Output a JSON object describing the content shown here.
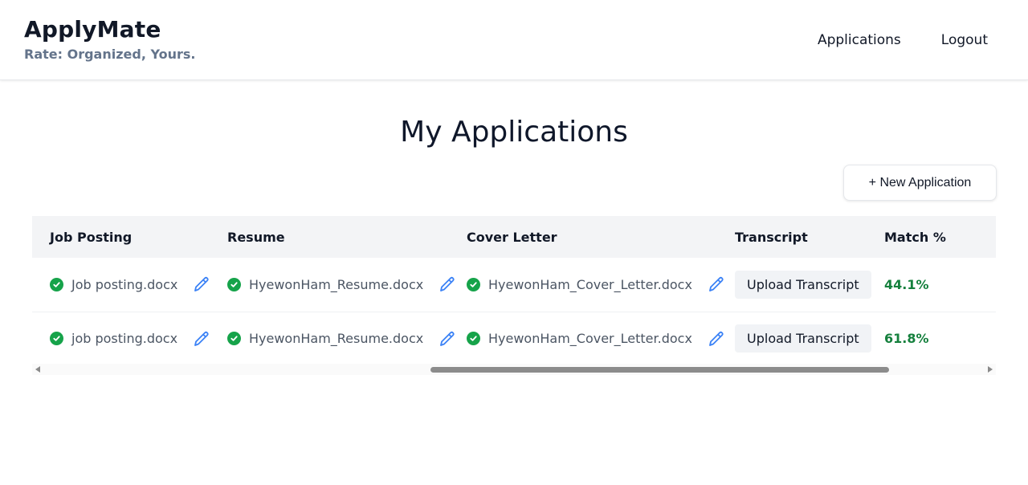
{
  "header": {
    "title": "ApplyMate",
    "tagline": "Rate: Organized, Yours.",
    "nav": [
      {
        "label": "Applications"
      },
      {
        "label": "Logout"
      }
    ]
  },
  "main": {
    "title": "My Applications",
    "new_button_label": "+ New Application"
  },
  "table": {
    "columns": [
      "Job Posting",
      "Resume",
      "Cover Letter",
      "Transcript",
      "Match %"
    ],
    "rows": [
      {
        "job_posting": "Job posting.docx",
        "resume": "HyewonHam_Resume.docx",
        "cover_letter": "HyewonHam_Cover_Letter.docx",
        "transcript_button": "Upload Transcript",
        "match": "44.1%"
      },
      {
        "job_posting": "job posting.docx",
        "resume": "HyewonHam_Resume.docx",
        "cover_letter": "HyewonHam_Cover_Letter.docx",
        "transcript_button": "Upload Transcript",
        "match": "61.8%"
      }
    ]
  },
  "icons": {
    "status": "check-circle-icon",
    "edit": "pencil-icon"
  },
  "colors": {
    "success": "#16a34a",
    "match_text": "#15803d",
    "edit_icon": "#3b82f6",
    "header_bg": "#f3f4f6"
  }
}
